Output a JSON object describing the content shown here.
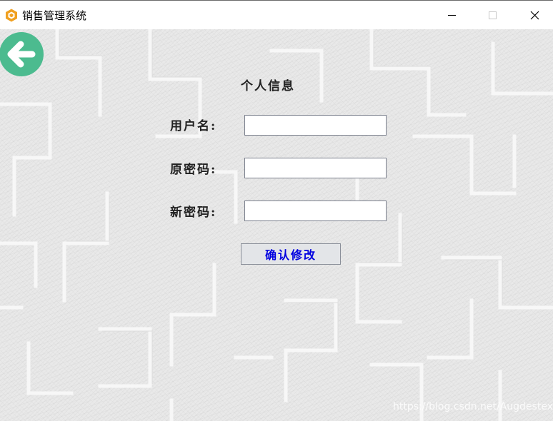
{
  "window": {
    "title": "销售管理系统",
    "app_icon": "hexagon-logo-icon",
    "controls": {
      "minimize_icon": "minimize-icon",
      "maximize_icon": "maximize-icon",
      "close_icon": "close-icon"
    }
  },
  "page": {
    "title": "个人信息",
    "back_icon": "arrow-left-icon",
    "fields": {
      "username": {
        "label": "用户名:",
        "value": ""
      },
      "old_password": {
        "label": "原密码:",
        "value": ""
      },
      "new_password": {
        "label": "新密码:",
        "value": ""
      }
    },
    "confirm_label": "确认修改"
  },
  "watermark": "https://blog.csdn.net/Augdestex",
  "colors": {
    "back_button": "#4cbb8f",
    "confirm_text": "#0000e0",
    "app_icon": "#f0a020",
    "background": "#e9e9e9"
  }
}
